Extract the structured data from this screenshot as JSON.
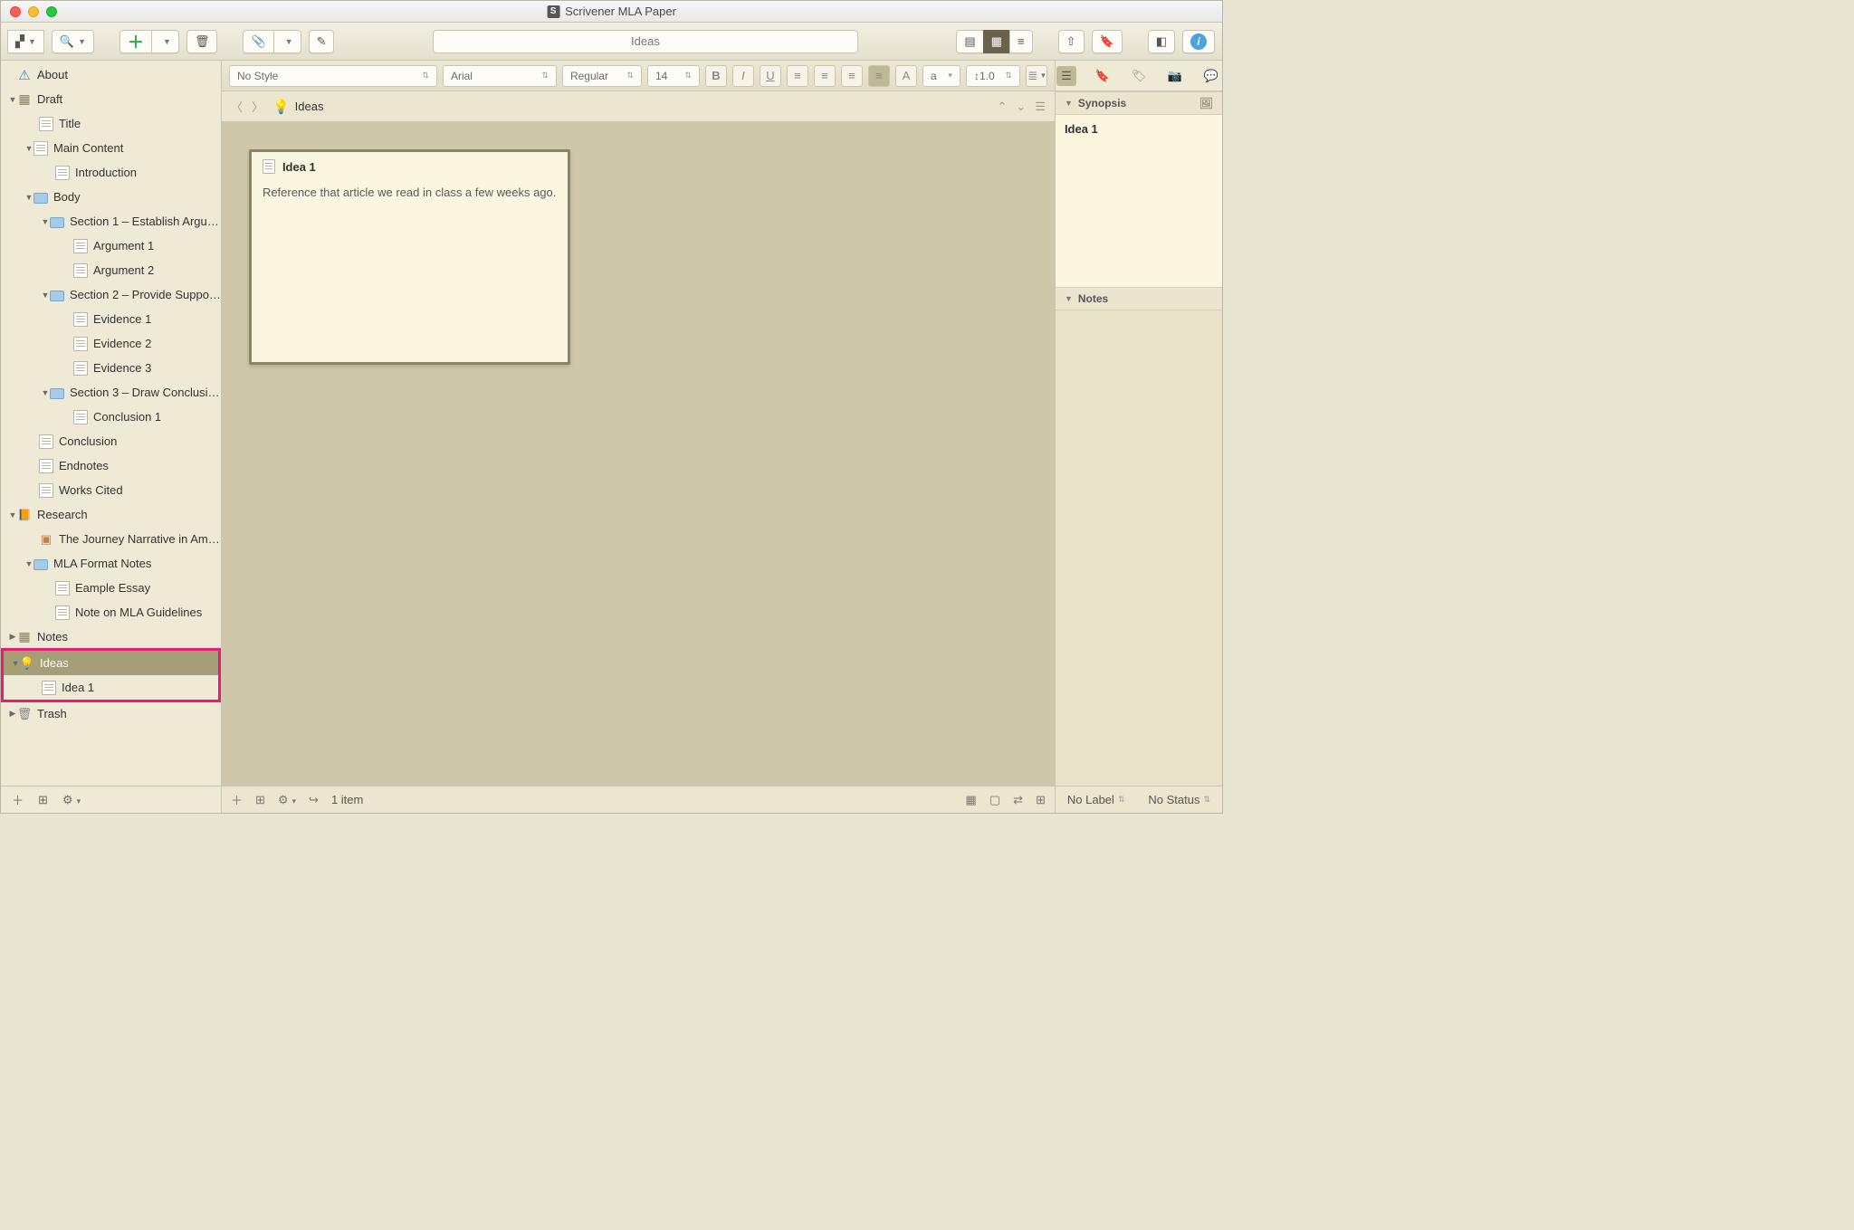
{
  "window_title": "Scrivener MLA Paper",
  "toolbar": {
    "search_center": "Ideas"
  },
  "format": {
    "style": "No Style",
    "font": "Arial",
    "weight": "Regular",
    "size": "14",
    "line": "1.0",
    "a": "a"
  },
  "nav": {
    "crumb": "Ideas"
  },
  "binder": {
    "about": "About",
    "draft": "Draft",
    "title": "Title",
    "main_content": "Main Content",
    "introduction": "Introduction",
    "body": "Body",
    "section1": "Section 1 – Establish Argu…",
    "argument1": "Argument 1",
    "argument2": "Argument 2",
    "section2": "Section 2 – Provide Suppo…",
    "evidence1": "Evidence 1",
    "evidence2": "Evidence 2",
    "evidence3": "Evidence 3",
    "section3": "Section 3 – Draw Conclusi…",
    "conclusion1": "Conclusion 1",
    "conclusion": "Conclusion",
    "endnotes": "Endnotes",
    "works_cited": "Works Cited",
    "research": "Research",
    "journey": "The Journey Narrative in Am…",
    "mla_notes": "MLA Format Notes",
    "example_essay": "Eample Essay",
    "note_mla": "Note on MLA Guidelines",
    "notes": "Notes",
    "ideas": "Ideas",
    "idea1": "Idea 1",
    "trash": "Trash"
  },
  "card": {
    "title": "Idea 1",
    "body": "Reference that article we read in class a few weeks ago."
  },
  "center_footer": {
    "count": "1 item"
  },
  "inspector": {
    "synopsis": "Synopsis",
    "syn_title": "Idea 1",
    "notes": "Notes",
    "no_label": "No Label",
    "no_status": "No Status"
  }
}
